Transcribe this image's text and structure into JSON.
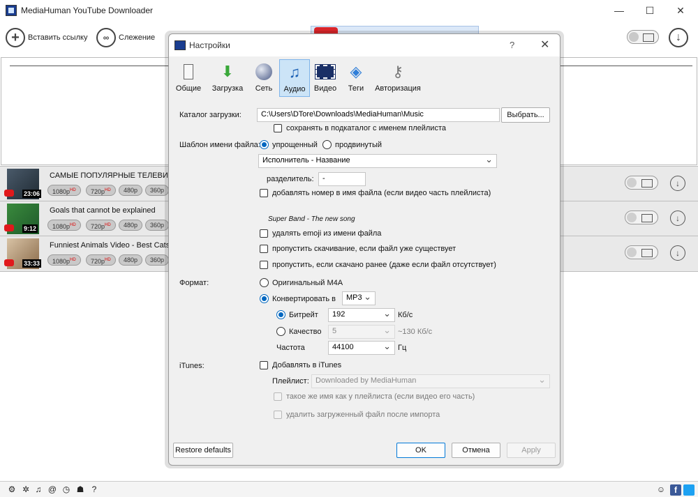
{
  "main": {
    "title": "MediaHuman YouTube Downloader",
    "paste_link": "Вставить ссылку",
    "tracking": "Слежение"
  },
  "videos": [
    {
      "title": "САМЫЕ ПОПУЛЯРНЫЕ ТЕЛЕВИЗОРЫ",
      "duration": "23:06",
      "qualities": [
        "1080p",
        "720p",
        "480p",
        "360p"
      ]
    },
    {
      "title": "Goals that cannot be explained",
      "duration": "9:12",
      "qualities": [
        "1080p",
        "720p",
        "480p",
        "360p"
      ]
    },
    {
      "title": "Funniest Animals Video - Best Cats",
      "duration": "33:33",
      "qualities": [
        "1080p",
        "720p",
        "480p",
        "360p"
      ]
    }
  ],
  "hd_badge": "HD",
  "dialog": {
    "title": "Настройки",
    "help": "?",
    "tabs": [
      {
        "label": "Общие",
        "icon": "general-icon"
      },
      {
        "label": "Загрузка",
        "icon": "download-arrow-icon"
      },
      {
        "label": "Сеть",
        "icon": "globe-icon"
      },
      {
        "label": "Аудио",
        "icon": "music-note-icon"
      },
      {
        "label": "Видео",
        "icon": "film-icon"
      },
      {
        "label": "Теги",
        "icon": "tag-icon"
      },
      {
        "label": "Авторизация",
        "icon": "keys-icon"
      }
    ],
    "active_tab": "Аудио",
    "download_dir_label": "Каталог загрузки:",
    "download_dir_value": "C:\\Users\\DTore\\Downloads\\MediaHuman\\Music",
    "browse": "Выбрать...",
    "save_subfolder": "сохранять в подкаталог с именем плейлиста",
    "filename_template_label": "Шаблон имени файла:",
    "simple": "упрощенный",
    "advanced": "продвинутый",
    "template_value": "Исполнитель - Название",
    "separator_label": "разделитель:",
    "separator_value": "-",
    "add_number": "добавлять номер в имя файла (если видео часть плейлиста)",
    "example": "Super Band - The new song",
    "remove_emoji": "удалять emoji из имени файла",
    "skip_existing": "пропустить скачивание, если файл уже существует",
    "skip_downloaded": "пропустить, если скачано ранее (даже если файл отсутствует)",
    "format_label": "Формат:",
    "original_m4a": "Оригинальный M4A",
    "convert_to": "Конвертировать в",
    "convert_format": "MP3",
    "bitrate": "Битрейт",
    "bitrate_value": "192",
    "bitrate_unit": "Кб/с",
    "quality": "Качество",
    "quality_value": "5",
    "quality_unit": "~130 Кб/с",
    "frequency": "Частота",
    "frequency_value": "44100",
    "frequency_unit": "Гц",
    "itunes_label": "iTunes:",
    "add_itunes": "Добавлять в iTunes",
    "playlist_label": "Плейлист:",
    "playlist_value": "Downloaded by MediaHuman",
    "same_name": "такое же имя как у плейлиста (если видео его часть)",
    "delete_after_import": "удалить загруженный файл после импорта",
    "restore": "Restore defaults",
    "ok": "OK",
    "cancel": "Отмена",
    "apply": "Apply"
  }
}
